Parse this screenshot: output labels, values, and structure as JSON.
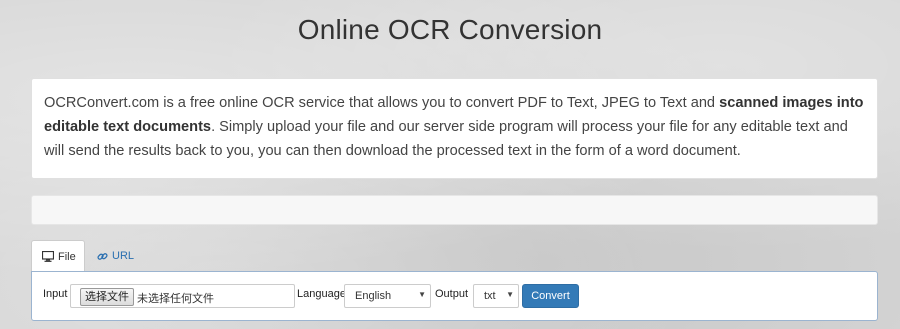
{
  "page": {
    "title": "Online OCR Conversion"
  },
  "description": {
    "part1": "OCRConvert.com is a free online OCR service that allows you to convert PDF to Text, JPEG to Text and ",
    "bold": "scanned images into editable text documents",
    "part2": ". Simply upload your file and our server side program will process your file for any editable text and will send the results back to you, you can then download the processed text in the form of a word document."
  },
  "tabs": [
    {
      "label": "File",
      "icon": "monitor-icon",
      "active": true
    },
    {
      "label": "URL",
      "icon": "link-icon",
      "active": false
    }
  ],
  "form": {
    "input_label": "Input",
    "choose_button": "选择文件",
    "no_file_text": "未选择任何文件",
    "language_label": "Language",
    "language_value": "English",
    "output_label": "Output",
    "output_value": "txt",
    "convert_button": "Convert"
  },
  "colors": {
    "accent": "#337ab7",
    "link": "#2a6fb0"
  }
}
